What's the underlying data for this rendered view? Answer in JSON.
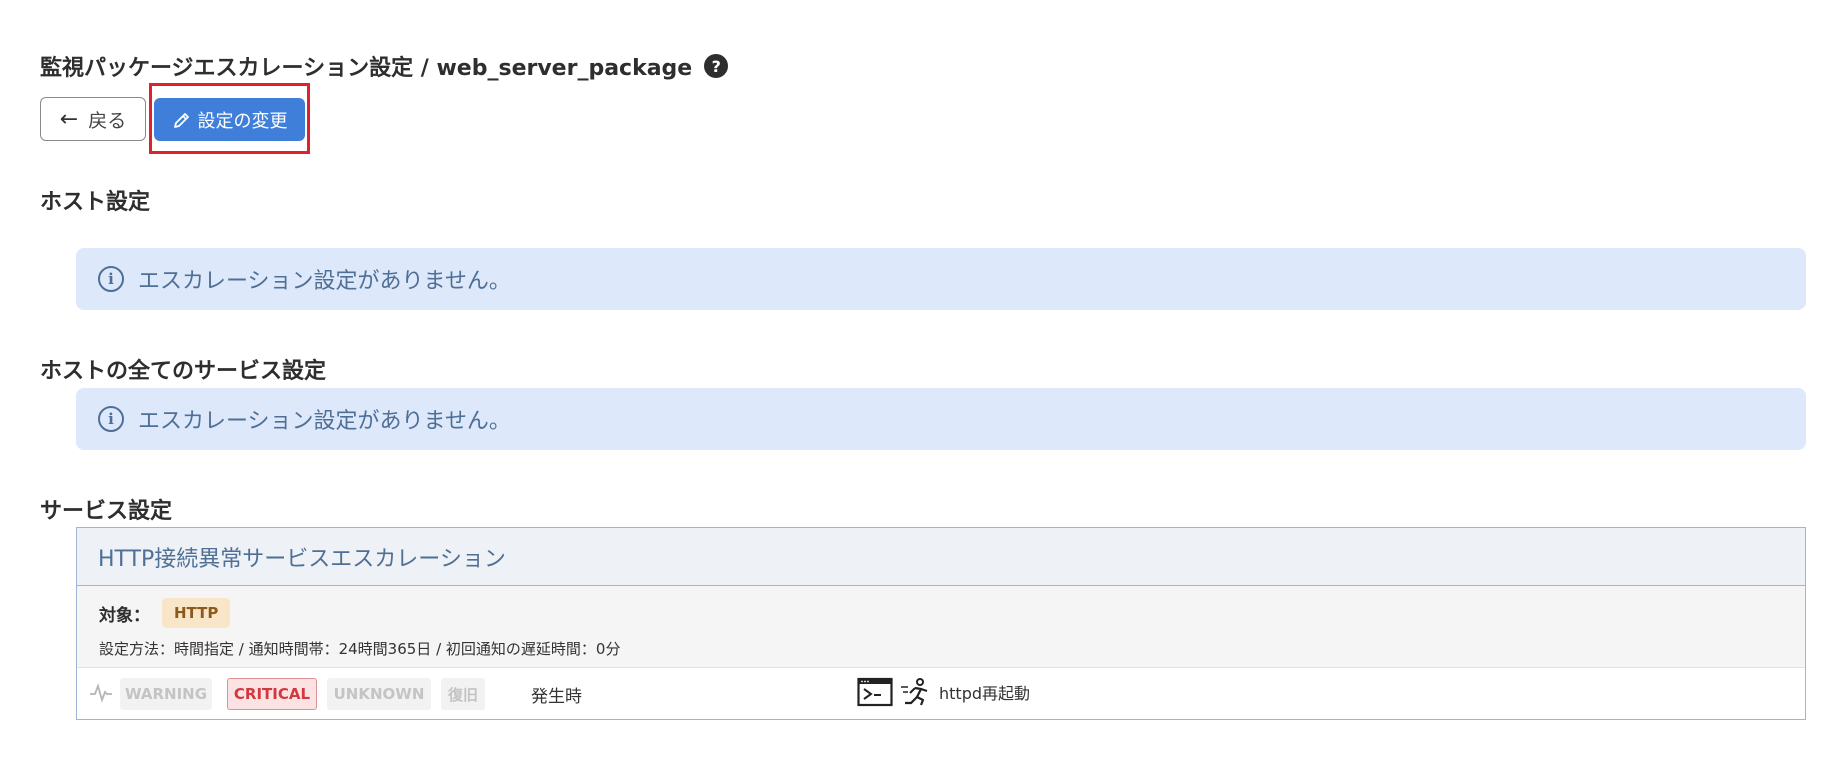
{
  "header": {
    "title": "監視パッケージエスカレーション設定 / web_server_package",
    "help_icon": "question-circle-icon"
  },
  "toolbar": {
    "back_label": "戻る",
    "edit_label": "設定の変更"
  },
  "sections": {
    "host": {
      "title": "ホスト設定",
      "message": "エスカレーション設定がありません。"
    },
    "all_services": {
      "title": "ホストの全てのサービス設定",
      "message": "エスカレーション設定がありません。"
    },
    "services": {
      "title": "サービス設定",
      "card": {
        "name": "HTTP接続異常サービスエスカレーション",
        "target_label": "対象：",
        "target_badge": "HTTP",
        "method_line": "設定方法：時間指定 / 通知時間帯：24時間365日 / 初回通知の遅延時間：0分",
        "states": [
          {
            "label": "WARNING",
            "active": false
          },
          {
            "label": "CRITICAL",
            "active": true
          },
          {
            "label": "UNKNOWN",
            "active": false
          },
          {
            "label": "復旧",
            "active": false
          }
        ],
        "timing": "発生時",
        "action": "httpd再起動"
      }
    }
  },
  "colors": {
    "primary": "#3f7fd9",
    "highlight": "#e0202a",
    "info_bg": "#dde9fb",
    "critical": "#d1383f"
  }
}
